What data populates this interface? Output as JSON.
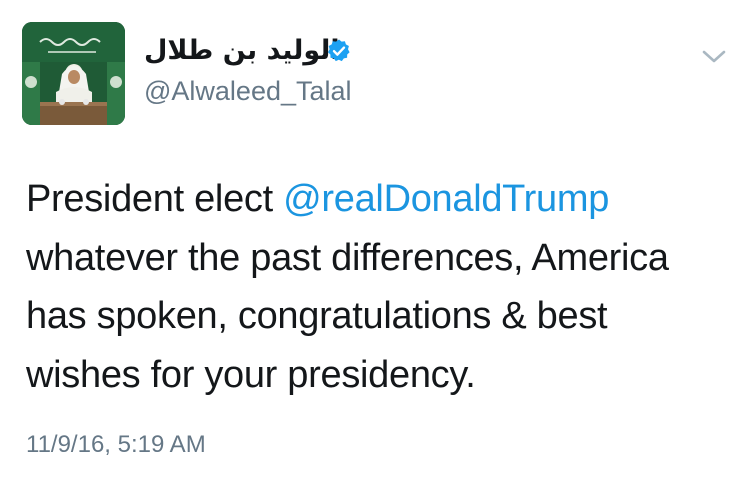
{
  "tweet": {
    "author": {
      "display_name": "الوليد بن طلال",
      "handle": "@Alwaleed_Talal",
      "verified": true,
      "avatar_icon": "profile-photo",
      "verified_icon": "verified-badge-icon"
    },
    "menu_icon": "chevron-down-icon",
    "text": {
      "line1_prefix": "President elect ",
      "mention": "@realDonaldTrump",
      "line2": "whatever the past differences, America",
      "line3": "has spoken, congratulations & best",
      "line4": "wishes for your presidency."
    },
    "timestamp": "11/9/16, 5:19 AM"
  },
  "colors": {
    "text": "#14171a",
    "secondary": "#657786",
    "link": "#1b95e0",
    "verified": "#1da1f2",
    "avatar_background": "#1f5b36"
  }
}
